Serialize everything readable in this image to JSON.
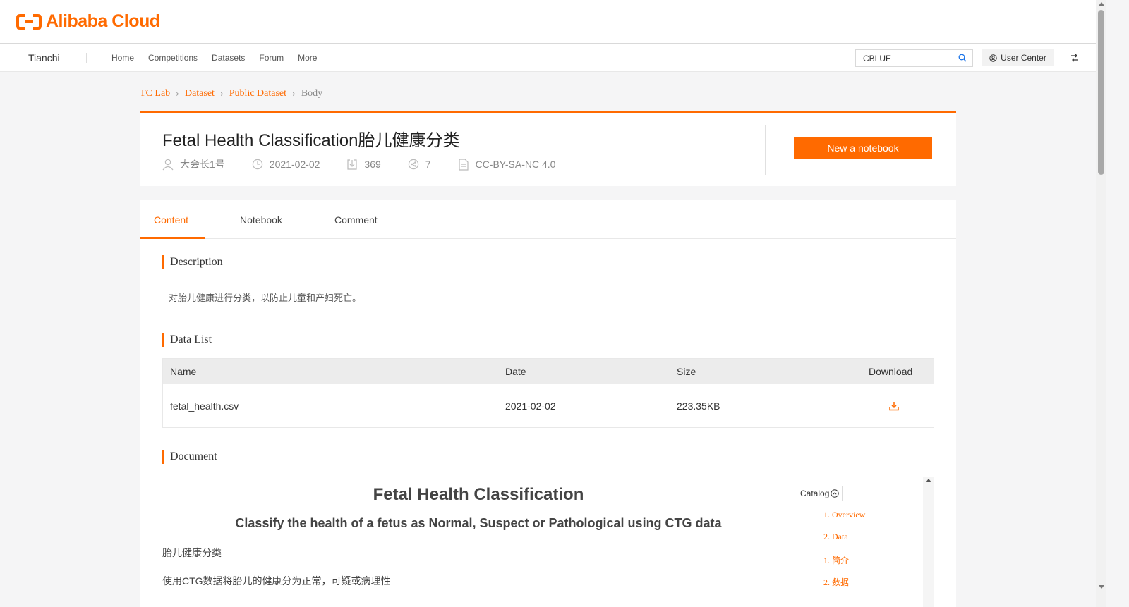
{
  "brand": {
    "logo_text": "Alibaba Cloud"
  },
  "nav": {
    "brand": "Tianchi",
    "links": [
      "Home",
      "Competitions",
      "Datasets",
      "Forum",
      "More"
    ],
    "search_value": "CBLUE",
    "user_center": "User Center"
  },
  "breadcrumb": [
    "TC Lab",
    "Dataset",
    "Public Dataset",
    "Body"
  ],
  "dataset": {
    "title": "Fetal Health Classification胎儿健康分类",
    "author": "大会长1号",
    "date": "2021-02-02",
    "downloads": "369",
    "shares": "7",
    "license": "CC-BY-SA-NC 4.0",
    "new_notebook": "New a notebook"
  },
  "tabs": [
    "Content",
    "Notebook",
    "Comment"
  ],
  "sections": {
    "description_title": "Description",
    "description_text": "对胎儿健康进行分类，以防止儿童和产妇死亡。",
    "datalist_title": "Data List",
    "document_title": "Document"
  },
  "table": {
    "headers": [
      "Name",
      "Date",
      "Size",
      "Download"
    ],
    "rows": [
      {
        "name": "fetal_health.csv",
        "date": "2021-02-02",
        "size": "223.35KB"
      }
    ]
  },
  "document": {
    "heading": "Fetal Health Classification",
    "subheading": "Classify the health of a fetus as Normal, Suspect or Pathological using CTG data",
    "p1": "胎儿健康分类",
    "p2": "使用CTG数据将胎儿的健康分为正常，可疑或病理性"
  },
  "catalog": {
    "label": "Catalog",
    "items": [
      "1. Overview",
      "2. Data",
      "1. 简介",
      "2. 数据"
    ]
  },
  "colors": {
    "accent": "#ff6a00"
  }
}
